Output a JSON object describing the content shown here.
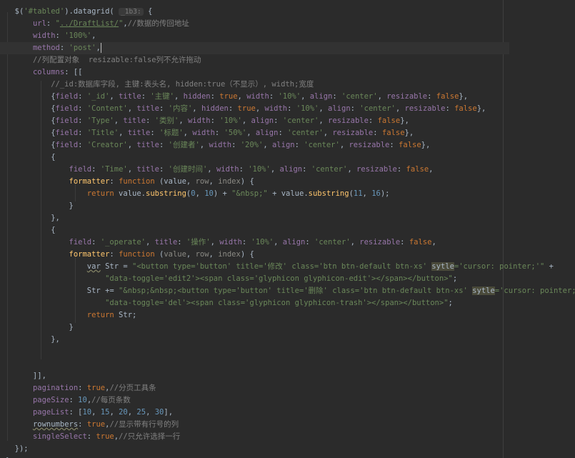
{
  "editor": {
    "current_line": 4,
    "lines": [
      [
        [
          "txt",
          "  $("
        ],
        [
          "str",
          "'#tabled'"
        ],
        [
          "txt",
          ").datagrid( "
        ],
        [
          "hint",
          "_1b3:"
        ],
        [
          "txt",
          " {"
        ]
      ],
      [
        [
          "txt",
          "      "
        ],
        [
          "prop",
          "url"
        ],
        [
          "txt",
          ": "
        ],
        [
          "str",
          "\""
        ],
        [
          "url",
          "../DraftList/"
        ],
        [
          "str",
          "\""
        ],
        [
          "txt",
          ","
        ],
        [
          "com",
          "//数据的传回地址"
        ]
      ],
      [
        [
          "txt",
          "      "
        ],
        [
          "prop",
          "width"
        ],
        [
          "txt",
          ": "
        ],
        [
          "str",
          "'100%'"
        ],
        [
          "txt",
          ","
        ]
      ],
      [
        [
          "txt",
          "      "
        ],
        [
          "prop",
          "method"
        ],
        [
          "txt",
          ": "
        ],
        [
          "str",
          "'post'"
        ],
        [
          "txt",
          ","
        ],
        [
          "caret",
          ""
        ]
      ],
      [
        [
          "txt",
          "      "
        ],
        [
          "com",
          "//列配置对象  resizable:false列不允许拖动"
        ]
      ],
      [
        [
          "txt",
          "      "
        ],
        [
          "prop",
          "columns"
        ],
        [
          "txt",
          ": [["
        ]
      ],
      [
        [
          "txt",
          "          "
        ],
        [
          "com",
          "//_id:数据库字段, 主键:表头名, hidden:true（不显示）, width;宽度"
        ]
      ],
      [
        [
          "txt",
          "          {"
        ],
        [
          "prop",
          "field"
        ],
        [
          "txt",
          ": "
        ],
        [
          "str",
          "'_id'"
        ],
        [
          "txt",
          ", "
        ],
        [
          "prop",
          "title"
        ],
        [
          "txt",
          ": "
        ],
        [
          "str",
          "'主键'"
        ],
        [
          "txt",
          ", "
        ],
        [
          "prop",
          "hidden"
        ],
        [
          "txt",
          ": "
        ],
        [
          "kw",
          "true"
        ],
        [
          "txt",
          ", "
        ],
        [
          "prop",
          "width"
        ],
        [
          "txt",
          ": "
        ],
        [
          "str",
          "'10%'"
        ],
        [
          "txt",
          ", "
        ],
        [
          "prop",
          "align"
        ],
        [
          "txt",
          ": "
        ],
        [
          "str",
          "'center'"
        ],
        [
          "txt",
          ", "
        ],
        [
          "prop",
          "resizable"
        ],
        [
          "txt",
          ": "
        ],
        [
          "kw",
          "false"
        ],
        [
          "txt",
          "},"
        ]
      ],
      [
        [
          "txt",
          "          {"
        ],
        [
          "prop",
          "field"
        ],
        [
          "txt",
          ": "
        ],
        [
          "str",
          "'Content'"
        ],
        [
          "txt",
          ", "
        ],
        [
          "prop",
          "title"
        ],
        [
          "txt",
          ": "
        ],
        [
          "str",
          "'内容'"
        ],
        [
          "txt",
          ", "
        ],
        [
          "prop",
          "hidden"
        ],
        [
          "txt",
          ": "
        ],
        [
          "kw",
          "true"
        ],
        [
          "txt",
          ", "
        ],
        [
          "prop",
          "width"
        ],
        [
          "txt",
          ": "
        ],
        [
          "str",
          "'10%'"
        ],
        [
          "txt",
          ", "
        ],
        [
          "prop",
          "align"
        ],
        [
          "txt",
          ": "
        ],
        [
          "str",
          "'center'"
        ],
        [
          "txt",
          ", "
        ],
        [
          "prop",
          "resizable"
        ],
        [
          "txt",
          ": "
        ],
        [
          "kw",
          "false"
        ],
        [
          "txt",
          "},"
        ]
      ],
      [
        [
          "txt",
          "          {"
        ],
        [
          "prop",
          "field"
        ],
        [
          "txt",
          ": "
        ],
        [
          "str",
          "'Type'"
        ],
        [
          "txt",
          ", "
        ],
        [
          "prop",
          "title"
        ],
        [
          "txt",
          ": "
        ],
        [
          "str",
          "'类别'"
        ],
        [
          "txt",
          ", "
        ],
        [
          "prop",
          "width"
        ],
        [
          "txt",
          ": "
        ],
        [
          "str",
          "'10%'"
        ],
        [
          "txt",
          ", "
        ],
        [
          "prop",
          "align"
        ],
        [
          "txt",
          ": "
        ],
        [
          "str",
          "'center'"
        ],
        [
          "txt",
          ", "
        ],
        [
          "prop",
          "resizable"
        ],
        [
          "txt",
          ": "
        ],
        [
          "kw",
          "false"
        ],
        [
          "txt",
          "},"
        ]
      ],
      [
        [
          "txt",
          "          {"
        ],
        [
          "prop",
          "field"
        ],
        [
          "txt",
          ": "
        ],
        [
          "str",
          "'Title'"
        ],
        [
          "txt",
          ", "
        ],
        [
          "prop",
          "title"
        ],
        [
          "txt",
          ": "
        ],
        [
          "str",
          "'标题'"
        ],
        [
          "txt",
          ", "
        ],
        [
          "prop",
          "width"
        ],
        [
          "txt",
          ": "
        ],
        [
          "str",
          "'50%'"
        ],
        [
          "txt",
          ", "
        ],
        [
          "prop",
          "align"
        ],
        [
          "txt",
          ": "
        ],
        [
          "str",
          "'center'"
        ],
        [
          "txt",
          ", "
        ],
        [
          "prop",
          "resizable"
        ],
        [
          "txt",
          ": "
        ],
        [
          "kw",
          "false"
        ],
        [
          "txt",
          "},"
        ]
      ],
      [
        [
          "txt",
          "          {"
        ],
        [
          "prop",
          "field"
        ],
        [
          "txt",
          ": "
        ],
        [
          "str",
          "'Creator'"
        ],
        [
          "txt",
          ", "
        ],
        [
          "prop",
          "title"
        ],
        [
          "txt",
          ": "
        ],
        [
          "str",
          "'创建者'"
        ],
        [
          "txt",
          ", "
        ],
        [
          "prop",
          "width"
        ],
        [
          "txt",
          ": "
        ],
        [
          "str",
          "'20%'"
        ],
        [
          "txt",
          ", "
        ],
        [
          "prop",
          "align"
        ],
        [
          "txt",
          ": "
        ],
        [
          "str",
          "'center'"
        ],
        [
          "txt",
          ", "
        ],
        [
          "prop",
          "resizable"
        ],
        [
          "txt",
          ": "
        ],
        [
          "kw",
          "false"
        ],
        [
          "txt",
          "},"
        ]
      ],
      [
        [
          "txt",
          "          {"
        ]
      ],
      [
        [
          "txt",
          "              "
        ],
        [
          "prop",
          "field"
        ],
        [
          "txt",
          ": "
        ],
        [
          "str",
          "'Time'"
        ],
        [
          "txt",
          ", "
        ],
        [
          "prop",
          "title"
        ],
        [
          "txt",
          ": "
        ],
        [
          "str",
          "'创建时间'"
        ],
        [
          "txt",
          ", "
        ],
        [
          "prop",
          "width"
        ],
        [
          "txt",
          ": "
        ],
        [
          "str",
          "'10%'"
        ],
        [
          "txt",
          ", "
        ],
        [
          "prop",
          "align"
        ],
        [
          "txt",
          ": "
        ],
        [
          "str",
          "'center'"
        ],
        [
          "txt",
          ", "
        ],
        [
          "prop",
          "resizable"
        ],
        [
          "txt",
          ": "
        ],
        [
          "kw",
          "false"
        ],
        [
          "txt",
          ","
        ]
      ],
      [
        [
          "txt",
          "              "
        ],
        [
          "fn",
          "formatter"
        ],
        [
          "txt",
          ": "
        ],
        [
          "kw",
          "function"
        ],
        [
          "txt",
          " (value, "
        ],
        [
          "par",
          "row"
        ],
        [
          "txt",
          ", "
        ],
        [
          "par",
          "index"
        ],
        [
          "txt",
          ") {"
        ]
      ],
      [
        [
          "txt",
          "                  "
        ],
        [
          "kw",
          "return"
        ],
        [
          "txt",
          " value."
        ],
        [
          "fn",
          "substring"
        ],
        [
          "txt",
          "("
        ],
        [
          "num",
          "0"
        ],
        [
          "txt",
          ", "
        ],
        [
          "num",
          "10"
        ],
        [
          "txt",
          ") + "
        ],
        [
          "str",
          "\"&nbsp;\""
        ],
        [
          "txt",
          " + value."
        ],
        [
          "fn",
          "substring"
        ],
        [
          "txt",
          "("
        ],
        [
          "num",
          "11"
        ],
        [
          "txt",
          ", "
        ],
        [
          "num",
          "16"
        ],
        [
          "txt",
          ");"
        ]
      ],
      [
        [
          "txt",
          "              }"
        ]
      ],
      [
        [
          "txt",
          "          },"
        ]
      ],
      [
        [
          "txt",
          "          {"
        ]
      ],
      [
        [
          "txt",
          "              "
        ],
        [
          "prop",
          "field"
        ],
        [
          "txt",
          ": "
        ],
        [
          "str",
          "'_operate'"
        ],
        [
          "txt",
          ", "
        ],
        [
          "prop",
          "title"
        ],
        [
          "txt",
          ": "
        ],
        [
          "str",
          "'操作'"
        ],
        [
          "txt",
          ", "
        ],
        [
          "prop",
          "width"
        ],
        [
          "txt",
          ": "
        ],
        [
          "str",
          "'10%'"
        ],
        [
          "txt",
          ", "
        ],
        [
          "prop",
          "align"
        ],
        [
          "txt",
          ": "
        ],
        [
          "str",
          "'center'"
        ],
        [
          "txt",
          ", "
        ],
        [
          "prop",
          "resizable"
        ],
        [
          "txt",
          ": "
        ],
        [
          "kw",
          "false"
        ],
        [
          "txt",
          ","
        ]
      ],
      [
        [
          "txt",
          "              "
        ],
        [
          "fn",
          "formatter"
        ],
        [
          "txt",
          ": "
        ],
        [
          "kw",
          "function"
        ],
        [
          "txt",
          " ("
        ],
        [
          "par",
          "value"
        ],
        [
          "txt",
          ", "
        ],
        [
          "par",
          "row"
        ],
        [
          "txt",
          ", "
        ],
        [
          "par",
          "index"
        ],
        [
          "txt",
          ") {"
        ]
      ],
      [
        [
          "txt",
          "                  "
        ],
        [
          "warn",
          "var"
        ],
        [
          "txt",
          " Str = "
        ],
        [
          "str",
          "\"<button type='button' title='修改' class='btn btn-default btn-xs' "
        ],
        [
          "hl",
          "sytle"
        ],
        [
          "str",
          "='cursor: pointer;'\""
        ],
        [
          "txt",
          " +"
        ]
      ],
      [
        [
          "txt",
          "                      "
        ],
        [
          "str",
          "\"data-toggle='edit2'><span class='glyphicon glyphicon-edit'></span></button>\""
        ],
        [
          "txt",
          ";"
        ]
      ],
      [
        [
          "txt",
          "                  Str += "
        ],
        [
          "str",
          "\"&nbsp;&nbsp;<button type='button' title='删除' class='btn btn-default btn-xs' "
        ],
        [
          "hl",
          "sytle"
        ],
        [
          "str",
          "='cursor: pointer;'\""
        ],
        [
          "txt",
          " +"
        ]
      ],
      [
        [
          "txt",
          "                      "
        ],
        [
          "str",
          "\"data-toggle='del'><span class='glyphicon glyphicon-trash'></span></button>\""
        ],
        [
          "txt",
          ";"
        ]
      ],
      [
        [
          "txt",
          "                  "
        ],
        [
          "kw",
          "return"
        ],
        [
          "txt",
          " Str;"
        ]
      ],
      [
        [
          "txt",
          "              }"
        ]
      ],
      [
        [
          "txt",
          "          },"
        ]
      ],
      [
        [
          "txt",
          ""
        ]
      ],
      [
        [
          "txt",
          ""
        ]
      ],
      [
        [
          "txt",
          "      ]],"
        ]
      ],
      [
        [
          "txt",
          "      "
        ],
        [
          "prop",
          "pagination"
        ],
        [
          "txt",
          ": "
        ],
        [
          "kw",
          "true"
        ],
        [
          "txt",
          ","
        ],
        [
          "com",
          "//分页工具条"
        ]
      ],
      [
        [
          "txt",
          "      "
        ],
        [
          "prop",
          "pageSize"
        ],
        [
          "txt",
          ": "
        ],
        [
          "num",
          "10"
        ],
        [
          "txt",
          ","
        ],
        [
          "com",
          "//每页条数"
        ]
      ],
      [
        [
          "txt",
          "      "
        ],
        [
          "prop",
          "pageList"
        ],
        [
          "txt",
          ": ["
        ],
        [
          "num",
          "10"
        ],
        [
          "txt",
          ", "
        ],
        [
          "num",
          "15"
        ],
        [
          "txt",
          ", "
        ],
        [
          "num",
          "20"
        ],
        [
          "txt",
          ", "
        ],
        [
          "num",
          "25"
        ],
        [
          "txt",
          ", "
        ],
        [
          "num",
          "30"
        ],
        [
          "txt",
          "],"
        ]
      ],
      [
        [
          "txt",
          "      "
        ],
        [
          "warn",
          "rownumbers"
        ],
        [
          "txt",
          ": "
        ],
        [
          "kw",
          "true"
        ],
        [
          "txt",
          ","
        ],
        [
          "com",
          "//显示带有行号的列"
        ]
      ],
      [
        [
          "txt",
          "      "
        ],
        [
          "prop",
          "singleSelect"
        ],
        [
          "txt",
          ": "
        ],
        [
          "kw",
          "true"
        ],
        [
          "txt",
          ","
        ],
        [
          "com",
          "//只允许选择一行"
        ]
      ],
      [
        [
          "txt",
          "  });"
        ]
      ],
      [
        [
          "txt",
          "}"
        ]
      ]
    ]
  }
}
